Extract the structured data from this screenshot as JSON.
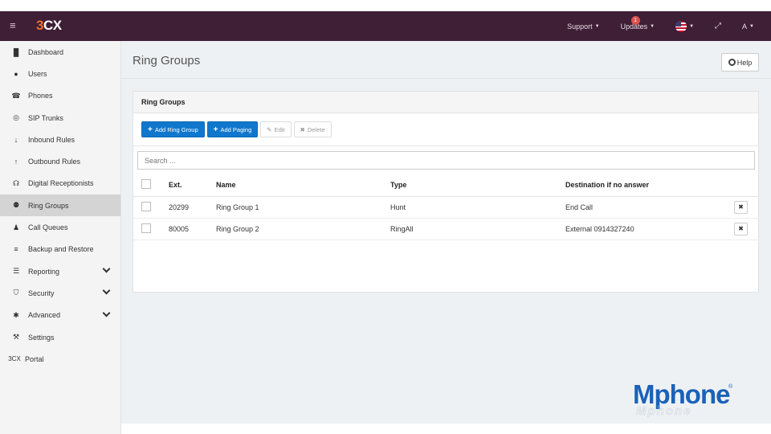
{
  "topbar": {
    "logo_three": "3",
    "logo_cx": "CX",
    "support_label": "Support",
    "updates_label": "Updates",
    "updates_badge": "1",
    "user_label": "A"
  },
  "sidebar": {
    "items": [
      {
        "label": "Dashboard",
        "icon": "bar-chart-icon",
        "glyph": "▐▌"
      },
      {
        "label": "Users",
        "icon": "user-icon",
        "glyph": "●"
      },
      {
        "label": "Phones",
        "icon": "phone-icon",
        "glyph": "☎"
      },
      {
        "label": "SIP Trunks",
        "icon": "globe-icon",
        "glyph": "◎"
      },
      {
        "label": "Inbound Rules",
        "icon": "arrow-down-icon",
        "glyph": "↓"
      },
      {
        "label": "Outbound Rules",
        "icon": "arrow-up-icon",
        "glyph": "↑"
      },
      {
        "label": "Digital Receptionists",
        "icon": "headset-icon",
        "glyph": "☊"
      },
      {
        "label": "Ring Groups",
        "icon": "group-icon",
        "glyph": "⚉"
      },
      {
        "label": "Call Queues",
        "icon": "users-icon",
        "glyph": "♟"
      },
      {
        "label": "Backup and Restore",
        "icon": "database-icon",
        "glyph": "≡"
      },
      {
        "label": "Reporting",
        "icon": "list-icon",
        "glyph": "☰"
      },
      {
        "label": "Security",
        "icon": "shield-icon",
        "glyph": "⛉"
      },
      {
        "label": "Advanced",
        "icon": "gear-icon",
        "glyph": "✱"
      },
      {
        "label": "Settings",
        "icon": "wrench-icon",
        "glyph": "⚒"
      },
      {
        "label": "Portal",
        "icon": "3cx-logo-icon",
        "glyph": "3CX"
      }
    ],
    "active_index": 7
  },
  "main": {
    "page_title": "Ring Groups",
    "help_label": "Help",
    "panel_title": "Ring Groups",
    "toolbar": {
      "add_ring_group": "Add Ring Group",
      "add_paging": "Add Paging",
      "edit": "Edit",
      "delete": "Delete"
    },
    "search_placeholder": "Search ...",
    "table": {
      "headers": [
        "Ext.",
        "Name",
        "Type",
        "Destination if no answer"
      ],
      "rows": [
        {
          "ext": "20299",
          "name": "Ring Group 1",
          "type": "Hunt",
          "destination": "End Call"
        },
        {
          "ext": "80005",
          "name": "Ring Group 2",
          "type": "RingAll",
          "destination": "External 0914327240"
        }
      ]
    }
  },
  "watermark": {
    "brand": "Mphone",
    "reg": "®"
  },
  "colors": {
    "topbar": "#3e1f35",
    "accent_orange": "#f36e2b",
    "primary_button": "#1177cc",
    "brand_blue": "#1a62b8"
  }
}
